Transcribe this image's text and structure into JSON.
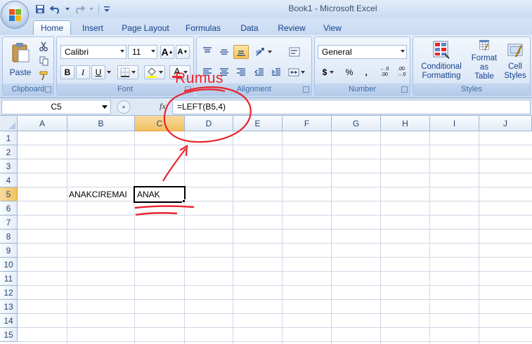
{
  "window": {
    "title": "Book1 - Microsoft Excel"
  },
  "tabs": [
    "Home",
    "Insert",
    "Page Layout",
    "Formulas",
    "Data",
    "Review",
    "View"
  ],
  "ribbon": {
    "clipboard": {
      "paste_label": "Paste",
      "group_label": "Clipboard"
    },
    "font": {
      "family": "Calibri",
      "size": "11",
      "bold": "B",
      "italic": "I",
      "underline": "U",
      "grow": "A",
      "shrink": "A",
      "font_color": "A",
      "group_label": "Font"
    },
    "alignment": {
      "group_label": "Alignment"
    },
    "number": {
      "format": "General",
      "currency": "$",
      "percent": "%",
      "comma": ",",
      "inc_decimal": "←.0 .00",
      "dec_decimal": ".00 →.0",
      "group_label": "Number"
    },
    "styles": {
      "conditional_1": "Conditional",
      "conditional_2": "Formatting",
      "table_1": "Format",
      "table_2": "as Table",
      "cell_1": "Cell",
      "cell_2": "Styles",
      "group_label": "Styles"
    }
  },
  "formula_bar": {
    "name_box": "C5",
    "fx": "fx",
    "formula": "=LEFT(B5,4)"
  },
  "grid": {
    "columns": [
      "A",
      "B",
      "C",
      "D",
      "E",
      "F",
      "G",
      "H",
      "I",
      "J"
    ],
    "rows": [
      "1",
      "2",
      "3",
      "4",
      "5",
      "6",
      "7",
      "8",
      "9",
      "10",
      "11",
      "12",
      "13",
      "14",
      "15"
    ],
    "selected_cell": "C5",
    "cells": {
      "B5": "ANAKCIREMAI",
      "C5": "ANAK"
    }
  },
  "annotation": {
    "label": "Rumus",
    "color": "#e8242c"
  }
}
